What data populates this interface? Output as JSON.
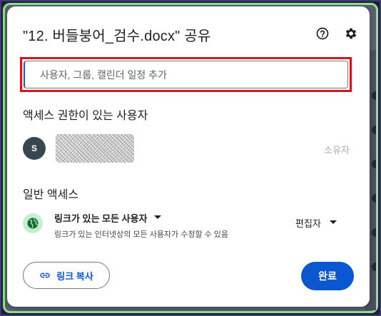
{
  "dialog": {
    "title": "\"12. 버들붕어_검수.docx\" 공유",
    "help_icon": "help-circle-icon",
    "settings_icon": "gear-icon"
  },
  "share_input": {
    "placeholder": "사용자, 그룹, 캘린더 일정 추가",
    "value": ""
  },
  "people_section": {
    "title": "액세스 권한이 있는 사용자",
    "people": [
      {
        "avatar_initial": "S",
        "role": "소유자"
      }
    ]
  },
  "general_access": {
    "title": "일반 액세스",
    "icon": "globe-icon",
    "selected_option": "링크가 있는 모든 사용자",
    "description": "링크가 있는 인터넷상의 모든 사용자가 수정할 수 있음",
    "role": "편집자"
  },
  "footer": {
    "copy_link_label": "링크 복사",
    "done_label": "완료"
  },
  "colors": {
    "primary": "#0b57d0",
    "highlight_border": "#d4151c",
    "avatar_bg": "#36474f",
    "globe_bg": "#c4eed0",
    "globe_fg": "#146c2e"
  }
}
